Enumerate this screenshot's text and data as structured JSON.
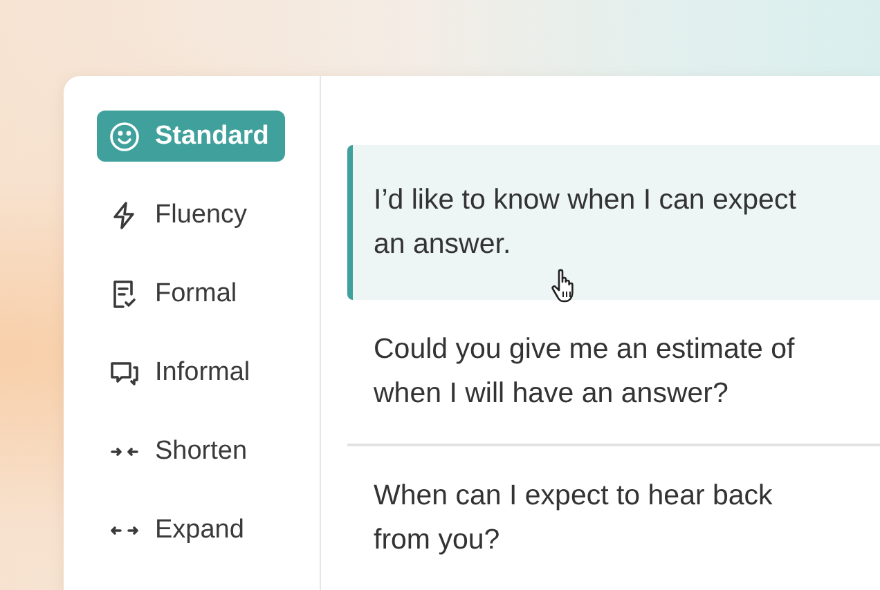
{
  "sidebar": {
    "items": [
      {
        "kind": "standard",
        "label": "Standard",
        "selected": true
      },
      {
        "kind": "fluency",
        "label": "Fluency",
        "selected": false
      },
      {
        "kind": "formal",
        "label": "Formal",
        "selected": false
      },
      {
        "kind": "informal",
        "label": "Informal",
        "selected": false
      },
      {
        "kind": "shorten",
        "label": "Shorten",
        "selected": false
      },
      {
        "kind": "expand",
        "label": "Expand",
        "selected": false
      }
    ]
  },
  "suggestions": [
    {
      "text": "I’d like to know when I can expect an answer.",
      "selected": true,
      "hovered": true
    },
    {
      "text": "Could you give me an estimate of when I will have an answer?",
      "selected": false,
      "hovered": false
    },
    {
      "text": "When can I expect to hear back from you?",
      "selected": false,
      "hovered": false
    }
  ]
}
